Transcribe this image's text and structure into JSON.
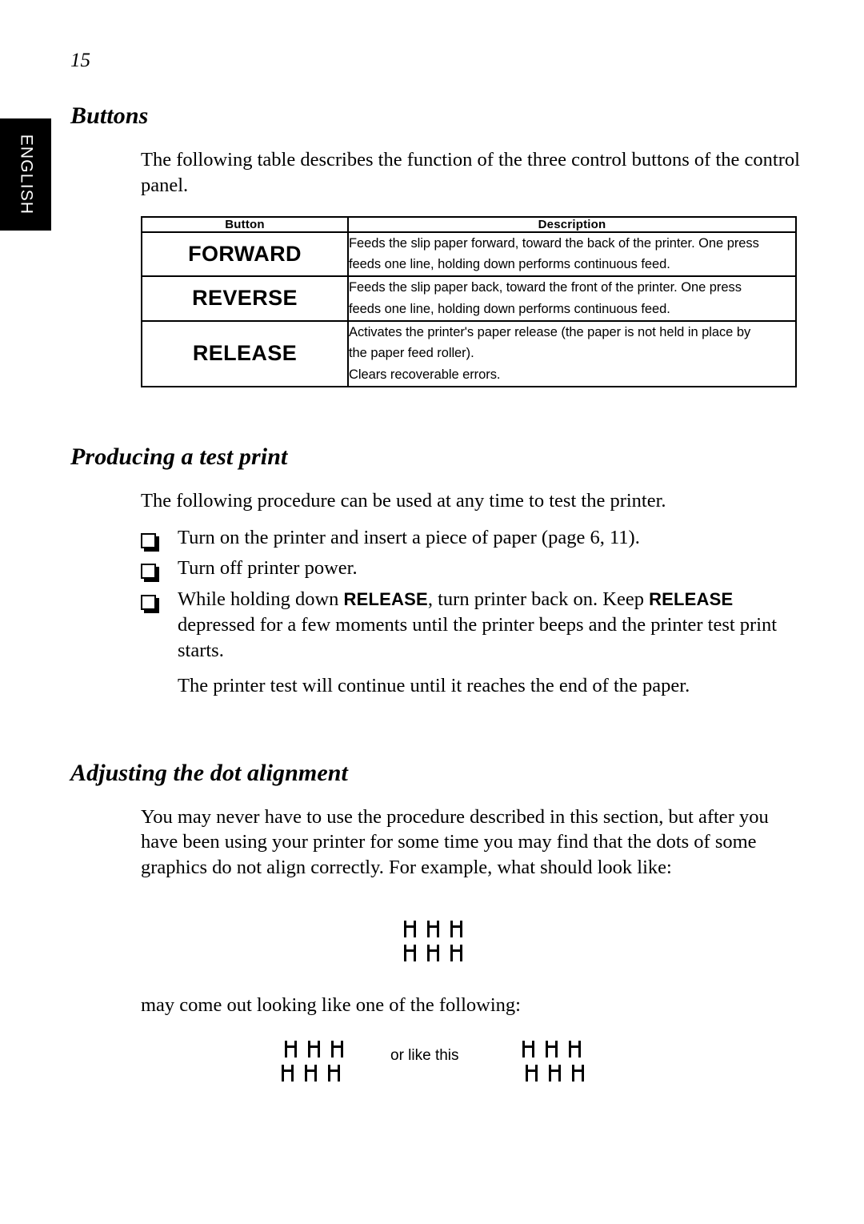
{
  "page": {
    "number": "15",
    "language_tab": "ENGLISH"
  },
  "sections": [
    {
      "id": "buttons",
      "title": "Buttons",
      "intro": "The following table describes the function of the three control buttons of the control panel."
    },
    {
      "id": "test-print",
      "title": "Producing a test print",
      "intro": "The following procedure can be used at any time to test the printer."
    },
    {
      "id": "dot-alignment",
      "title": "Adjusting the dot alignment",
      "intro": "You may never have to use the procedure described in this section, but after you have been using your printer for some time you may find that the dots of some graphics do not align correctly. For example, what should look like:"
    }
  ],
  "table": {
    "headers": {
      "button": "Button",
      "description": "Description"
    },
    "rows": [
      {
        "button": "FORWARD",
        "description_lines": [
          "Feeds the slip paper forward, toward the back of the printer. One press",
          "feeds one line, holding down performs continuous feed."
        ]
      },
      {
        "button": "REVERSE",
        "description_lines": [
          "Feeds the slip paper back, toward the front of the printer. One press",
          "feeds one line, holding down performs continuous feed."
        ]
      },
      {
        "button": "RELEASE",
        "description_lines": [
          "Activates the printer's paper release (the paper is not held in place by",
          "the paper feed roller).",
          "Clears recoverable errors."
        ]
      }
    ]
  },
  "test_print_steps": [
    {
      "parts": [
        {
          "text": "Turn on the printer and insert a piece of paper (page 6, 11).",
          "style": "normal"
        }
      ]
    },
    {
      "parts": [
        {
          "text": "Turn off printer power.",
          "style": "normal"
        }
      ]
    },
    {
      "parts": [
        {
          "text": "While holding down ",
          "style": "normal"
        },
        {
          "text": "RELEASE",
          "style": "bold-sans"
        },
        {
          "text": ", turn printer back on. Keep ",
          "style": "normal"
        },
        {
          "text": "RELEASE",
          "style": "bold-sans"
        },
        {
          "text": " depressed for a few moments until the printer beeps and the printer test print starts.",
          "style": "normal"
        }
      ]
    }
  ],
  "test_print_note": "The printer test will continue until it reaches the end of the paper.",
  "dot_alignment": {
    "middle_text": "may come out looking like one of the following:",
    "or_like_this": "or like this"
  }
}
